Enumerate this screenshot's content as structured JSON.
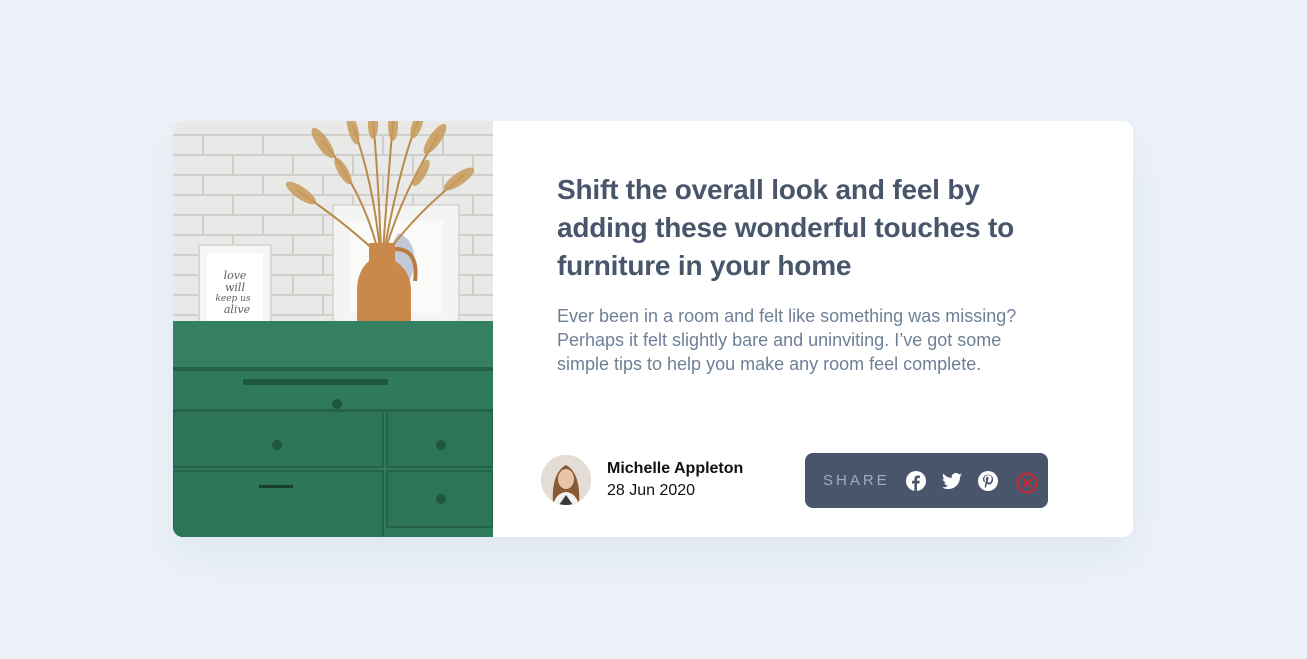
{
  "article": {
    "title": "Shift the overall look and feel by adding these wonderful touches to furniture in your home",
    "excerpt": "Ever been in a room and felt like something was missing? Perhaps it felt slightly bare and uninviting. I’ve got some simple tips to help you make any room feel complete.",
    "image_text": "love will keep us alive"
  },
  "author": {
    "name": "Michelle Appleton",
    "date": "28 Jun 2020"
  },
  "share": {
    "label": "SHARE",
    "icons": [
      "facebook-icon",
      "twitter-icon",
      "pinterest-icon",
      "close-icon"
    ]
  },
  "colors": {
    "page_bg": "#ECF2F8",
    "card_bg": "#FFFFFF",
    "heading": "#48556A",
    "body_text": "#6E8098",
    "share_bar": "#48556A",
    "share_label": "#9DAEC2",
    "close_icon": "#D2262F",
    "drawer_green": "#2F7A5C"
  }
}
